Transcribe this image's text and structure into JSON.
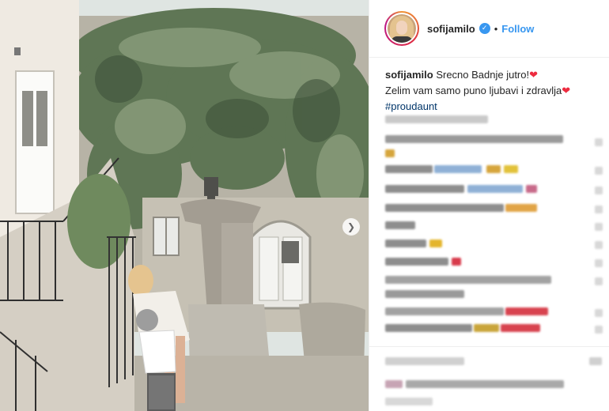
{
  "post": {
    "username": "sofijamilo",
    "follow_label": "Follow",
    "separator": "•",
    "verified_glyph": "✓",
    "caption": {
      "username": "sofijamilo",
      "line1": "Srecno Badnje jutro!",
      "line2": "Zelim vam samo puno ljubavi i zdravlja",
      "hashtag": "#proudaunt",
      "heart": "❤"
    },
    "next_glyph": "❯"
  },
  "icons": {
    "avatar": "profile-photo",
    "verified": "verified-badge-icon",
    "next": "chevron-right-icon",
    "heart": "red-heart-emoji"
  },
  "colors": {
    "accent": "#3897f0",
    "hashtag": "#003569",
    "heart": "#ed2c40",
    "border": "#efefef"
  }
}
